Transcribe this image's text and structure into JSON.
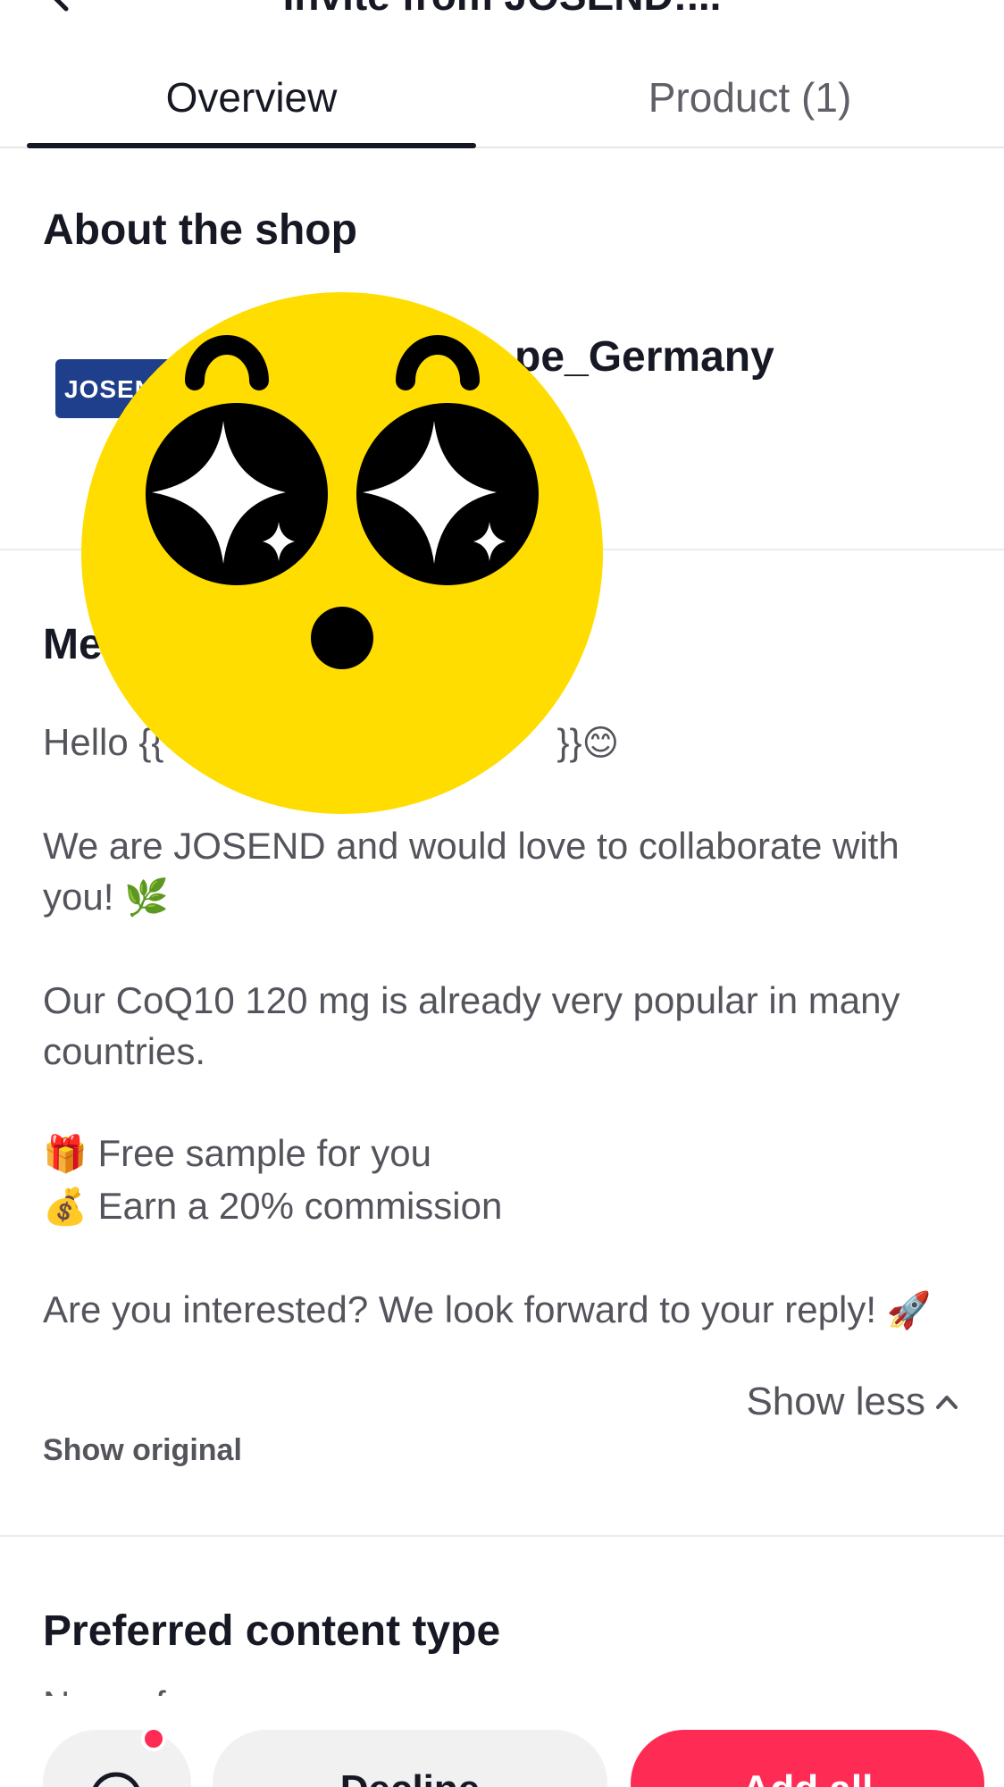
{
  "header": {
    "title": "Invite from JOSEND:..."
  },
  "tabs": [
    {
      "label": "Overview",
      "active": true
    },
    {
      "label": "Product (1)",
      "active": false
    }
  ],
  "about": {
    "title": "About the shop",
    "logo_text": "JOSEND",
    "shop_name": "pe_Germany"
  },
  "message": {
    "title": "Me",
    "greeting": "Hello {{",
    "greeting_end": "}}",
    "greeting_emoji": "😊",
    "paragraph1": "We are JOSEND and would love to collaborate with you!",
    "paragraph1_emoji": "🌿",
    "paragraph2": "Our CoQ10 120 mg is already very popular in many countries.",
    "perk1_emoji": "🎁",
    "perk1": "Free sample for you",
    "perk2_emoji": "💰",
    "perk2": "Earn a 20% commission",
    "paragraph4": "Are you interested? We look forward to your reply!",
    "paragraph4_emoji": "🚀",
    "show_less_label": "Show less",
    "show_original_label": "Show original"
  },
  "preferred": {
    "title": "Preferred content type",
    "value": "No preference"
  },
  "bottom": {
    "decline_label": "Decline",
    "add_all_label": "Add all"
  },
  "colors": {
    "accent": "#fe2c55",
    "logo_blue": "#1f3f8c",
    "sticker_yellow": "#ffdd00"
  },
  "icons": [
    "back-arrow-icon",
    "chevron-up-icon",
    "chat-bubble-icon",
    "starstruck-emoji-sticker"
  ]
}
